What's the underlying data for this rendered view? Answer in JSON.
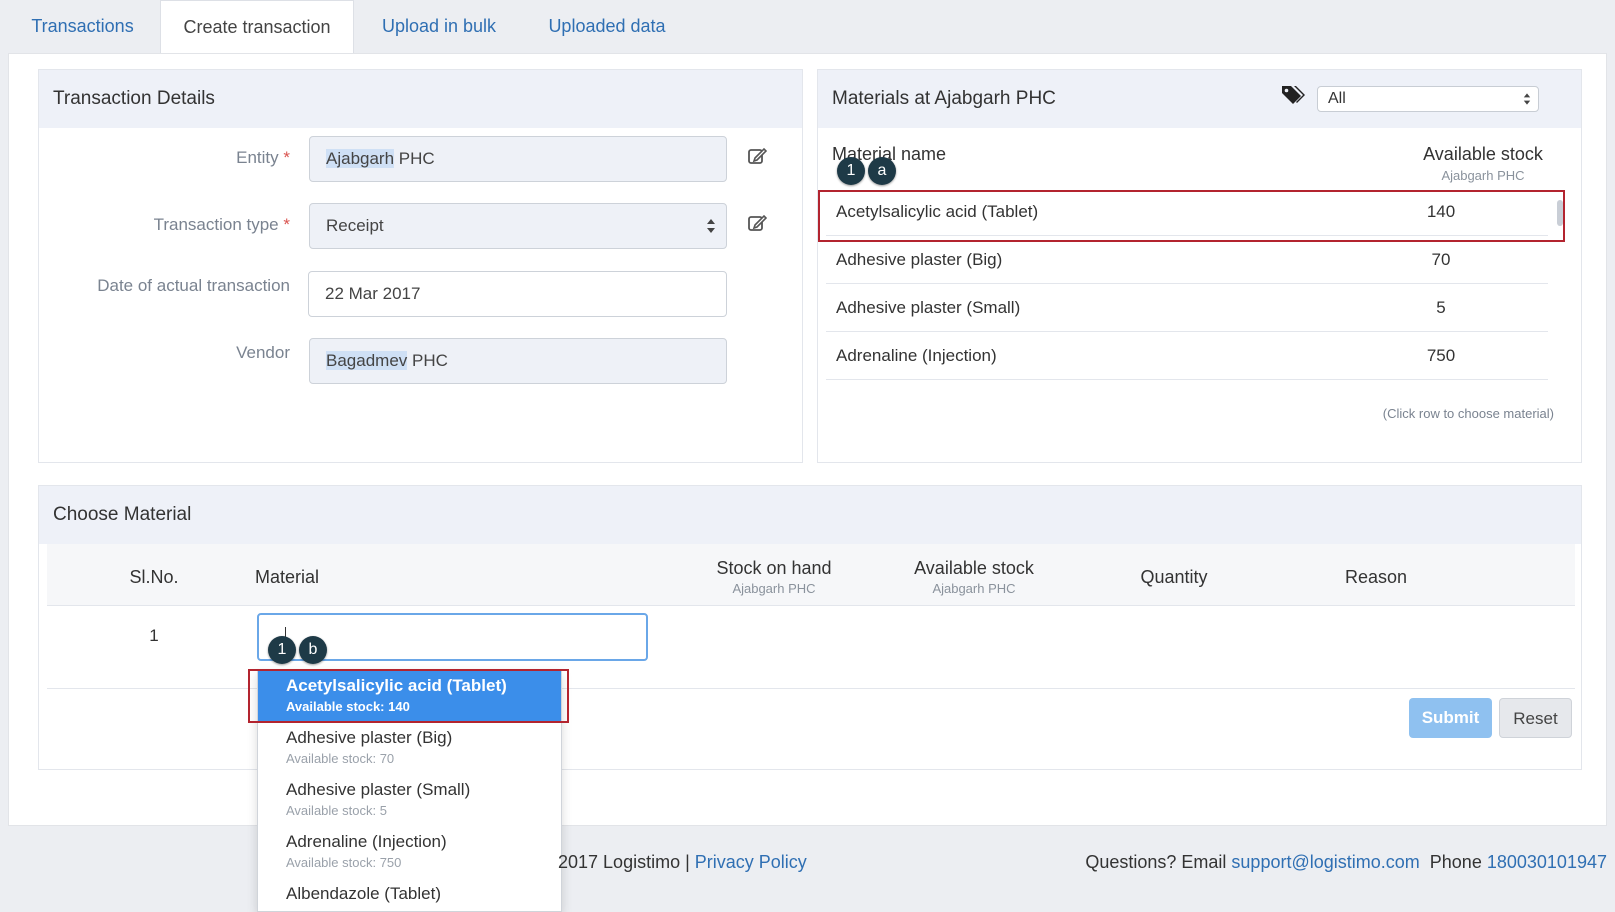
{
  "tabs": [
    "Transactions",
    "Create transaction",
    "Upload in bulk",
    "Uploaded data"
  ],
  "details": {
    "title": "Transaction Details",
    "entity_label": "Entity",
    "entity_highlight": "Ajabgarh",
    "entity_rest": " PHC",
    "type_label": "Transaction type",
    "type_value": "Receipt",
    "date_label": "Date of actual transaction",
    "date_value": "22 Mar 2017",
    "vendor_label": "Vendor",
    "vendor_highlight": "Bagadmev",
    "vendor_rest": " PHC",
    "required_mark": "*"
  },
  "materials_panel": {
    "title": "Materials at Ajabgarh PHC",
    "filter_value": "All",
    "col_name": "Material name",
    "col_stock": "Available stock",
    "col_stock_sub": "Ajabgarh PHC",
    "rows": [
      {
        "name": "Acetylsalicylic acid (Tablet)",
        "stock": "140"
      },
      {
        "name": "Adhesive plaster (Big)",
        "stock": "70"
      },
      {
        "name": "Adhesive plaster (Small)",
        "stock": "5"
      },
      {
        "name": "Adrenaline (Injection)",
        "stock": "750"
      }
    ],
    "hint": "(Click row to choose material)"
  },
  "choose": {
    "title": "Choose Material",
    "headers": {
      "slno": "Sl.No.",
      "material": "Material",
      "stock_on_hand": "Stock on hand",
      "stock_on_hand_sub": "Ajabgarh PHC",
      "available": "Available stock",
      "available_sub": "Ajabgarh PHC",
      "quantity": "Quantity",
      "reason": "Reason"
    },
    "row_no": "1",
    "submit": "Submit",
    "reset": "Reset"
  },
  "dropdown": [
    {
      "name": "Acetylsalicylic acid (Tablet)",
      "stock": "Available stock: 140"
    },
    {
      "name": "Adhesive plaster (Big)",
      "stock": "Available stock: 70"
    },
    {
      "name": "Adhesive plaster (Small)",
      "stock": "Available stock: 5"
    },
    {
      "name": "Adrenaline (Injection)",
      "stock": "Available stock: 750"
    },
    {
      "name": "Albendazole (Tablet)",
      "stock": ""
    }
  ],
  "badges": {
    "a1": "1",
    "a2": "a",
    "b1": "1",
    "b2": "b"
  },
  "footer": {
    "copyright": "2017 Logistimo |",
    "privacy": "Privacy Policy",
    "questions": "Questions? Email",
    "email": "support@logistimo.com",
    "phone_label": "Phone",
    "phone": "180030101947"
  },
  "colors": {
    "accent": "#2f6fb3",
    "highlight_border": "#b3242f",
    "badge": "#1e3a47",
    "dropdown_selected": "#3b8eea"
  }
}
